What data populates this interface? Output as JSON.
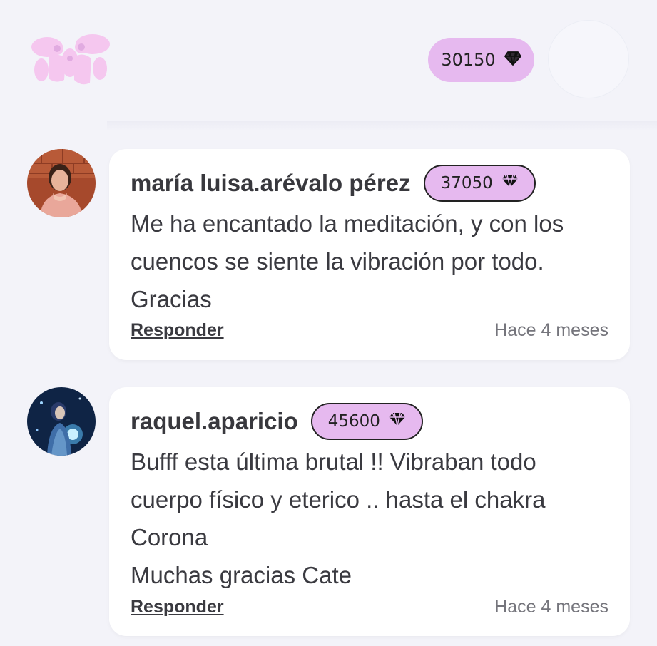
{
  "header": {
    "gem_count": "30150",
    "gem_icon": "diamond-icon",
    "logo_icon": "angels-logo"
  },
  "comments": [
    {
      "username": "maría luisa.arévalo pérez",
      "gems": "37050",
      "text": "Me ha encantado la meditación, y con los cuencos se siente la vibración por todo. Gracias",
      "reply_label": "Responder",
      "time": "Hace 4 meses"
    },
    {
      "username": "raquel.aparicio",
      "gems": "45600",
      "text_lines": [
        "Bufff esta última brutal !! Vibraban todo cuerpo físico y eterico .. hasta el chakra Corona",
        "Muchas gracias Cate"
      ],
      "reply_label": "Responder",
      "time": "Hace 4 meses"
    }
  ]
}
